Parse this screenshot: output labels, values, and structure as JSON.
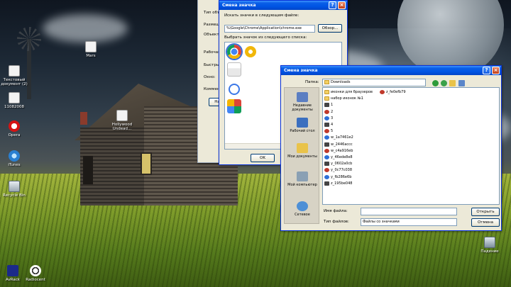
{
  "desktop": {
    "icons": [
      {
        "label": "Mars",
        "icon": "image-file-icon"
      },
      {
        "label": "Текстовый документ (2)",
        "icon": "text-document-icon"
      },
      {
        "label": "11082008",
        "icon": "document-icon"
      },
      {
        "label": "Opera",
        "icon": "opera-icon"
      },
      {
        "label": "iTunes",
        "icon": "itunes-icon"
      },
      {
        "label": "Recycle Bin",
        "icon": "recycle-bin-icon"
      },
      {
        "label": "Hollywood Undead...",
        "icon": "audio-file-icon"
      },
      {
        "label": "AvRack",
        "icon": "aim-icon"
      },
      {
        "label": "Radiocent",
        "icon": "radio-icon"
      },
      {
        "label": "Падение",
        "icon": "batch-file-icon"
      }
    ]
  },
  "properties": {
    "labels": [
      "Тип объ",
      "Размещ",
      "Объект",
      "Рабочая",
      "Быстры",
      "Окно:",
      "Коммен",
      "На"
    ]
  },
  "icon_dialog": {
    "title": "Смена значка",
    "search_label": "Искать значки в следующем файле:",
    "file_path": "%\\Google\\Chrome\\Application\\chrome.exe",
    "browse_button": "Обзор...",
    "select_label": "Выбрать значок из следующего списка:",
    "ok_button": "OK",
    "icons": [
      "chrome-icon",
      "chrome-yellow-icon",
      "google-icon",
      "google-g-icon",
      "google-blocks-icon"
    ]
  },
  "file_dialog": {
    "title": "Смена значка",
    "folder_label": "Папка:",
    "folder_value": "Downloads",
    "places": [
      {
        "label": "Недавние документы",
        "icon": "recent-documents-icon"
      },
      {
        "label": "Рабочий стол",
        "icon": "desktop-icon"
      },
      {
        "label": "Мои документы",
        "icon": "my-documents-icon"
      },
      {
        "label": "Мой компьютер",
        "icon": "my-computer-icon"
      },
      {
        "label": "Сетевое",
        "icon": "network-icon"
      }
    ],
    "files_col1": [
      {
        "name": "иконки для браузеров",
        "type": "folder"
      },
      {
        "name": "набор иконок №1",
        "type": "folder"
      },
      {
        "name": "1",
        "type": "ico"
      },
      {
        "name": "2",
        "type": "ico"
      },
      {
        "name": "3",
        "type": "ico"
      },
      {
        "name": "4",
        "type": "ico"
      },
      {
        "name": "5",
        "type": "ico"
      },
      {
        "name": "w_1a7461e2",
        "type": "ico"
      },
      {
        "name": "w_2446accc",
        "type": "ico"
      },
      {
        "name": "w_c4a916eb",
        "type": "ico"
      },
      {
        "name": "y_46ede8e8",
        "type": "ico"
      },
      {
        "name": "y_0602a0cb",
        "type": "ico"
      },
      {
        "name": "y_0c77c038",
        "type": "ico"
      },
      {
        "name": "y_fb286e6b",
        "type": "ico"
      },
      {
        "name": "z_195be048",
        "type": "ico"
      }
    ],
    "files_col2": [
      {
        "name": "z_fe0efb79",
        "type": "ico"
      }
    ],
    "filename_label": "Имя файла:",
    "filename_value": "",
    "filetype_label": "Тип файлов:",
    "filetype_value": "Файлы со значками",
    "open_button": "Открыть",
    "cancel_button": "Отмена"
  }
}
